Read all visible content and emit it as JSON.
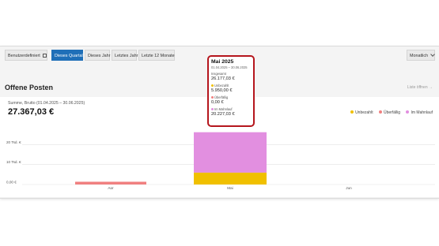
{
  "toolbar": {
    "custom_label": "Benutzerdefiniert",
    "buttons": [
      "Dieses Quartal",
      "Dieses Jahr",
      "Letztes Jahr",
      "Letzte 12 Monate"
    ],
    "active_button": "Dieses Quartal",
    "interval_label": "Monatlich"
  },
  "section": {
    "title": "Offene Posten",
    "list_link": "Liste öffnen →"
  },
  "kpi": {
    "label": "Summe, Brutto (01.04.2025 – 30.06.2025)",
    "value": "27.367,03 €"
  },
  "legend": [
    {
      "label": "Unbezahlt",
      "color": "#f0c000"
    },
    {
      "label": "Überfällig",
      "color": "#f08080"
    },
    {
      "label": "Im Mahnlauf",
      "color": "#e28fe0"
    }
  ],
  "tooltip": {
    "title": "Mai 2025",
    "range": "01.04.2025 – 30.06.2025",
    "rows": [
      {
        "label": "Insgesamt",
        "value": "26.177,03 €",
        "color": ""
      },
      {
        "label": "Unbezahlt",
        "value": "5.950,00 €",
        "color": "#f0c000"
      },
      {
        "label": "Überfällig",
        "value": "0,00 €",
        "color": "#f08080"
      },
      {
        "label": "Im Mahnlauf",
        "value": "20.227,03 €",
        "color": "#e28fe0"
      }
    ]
  },
  "chart_data": {
    "type": "bar",
    "stacked": true,
    "categories": [
      "Apr",
      "Mai",
      "Jun"
    ],
    "series": [
      {
        "name": "Unbezahlt",
        "color": "#f0c000",
        "values": [
          0,
          5950.0,
          0
        ]
      },
      {
        "name": "Überfällig",
        "color": "#f08080",
        "values": [
          1190.0,
          0,
          0
        ]
      },
      {
        "name": "Im Mahnlauf",
        "color": "#e28fe0",
        "values": [
          0,
          20227.03,
          0
        ]
      }
    ],
    "ytick_labels": [
      "0,00 €",
      "10 Tsd. €",
      "20 Tsd. €"
    ],
    "ytick_values": [
      0,
      10000,
      20000
    ],
    "ylim": [
      0,
      30000
    ],
    "grid": true,
    "legend_position": "top-right"
  }
}
